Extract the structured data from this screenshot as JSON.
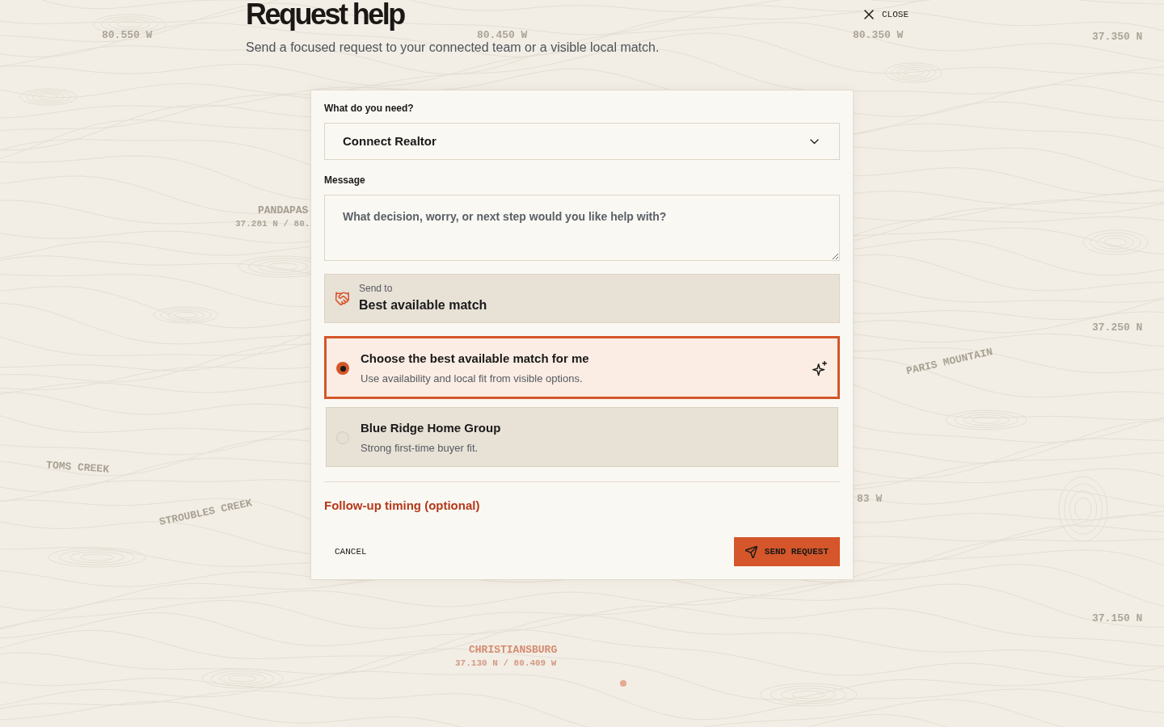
{
  "header": {
    "title": "Request help",
    "subtitle": "Send a focused request to your connected team or a visible local match.",
    "close_button": "CLOSE"
  },
  "form": {
    "need": {
      "label": "What do you need?",
      "value": "Connect Realtor"
    },
    "message": {
      "label": "Message",
      "placeholder": "What decision, worry, or next step would you like help with?"
    },
    "send_to": {
      "label": "Send to",
      "value": "Best available match"
    },
    "options": [
      {
        "kind": "auto",
        "title": "Choose the best available match for me",
        "description": "Use availability and local fit from visible options.",
        "selected": true
      },
      {
        "kind": "agent",
        "title": "Blue Ridge Home Group",
        "description": "Strong first-time buyer fit.",
        "selected": false
      }
    ],
    "follow_up_link": "Follow-up timing (optional)",
    "cancel_button": "CANCEL",
    "submit_button": "SEND REQUEST"
  },
  "map": {
    "grid_labels": [
      "80.550 W",
      "80.450 W",
      "80.350 W",
      "37.350 N",
      "37.250 N",
      "83 W",
      "37.150 N"
    ],
    "feature_labels": [
      "PARIS MOUNTAIN",
      "TOMS CREEK",
      "STROUBLES CREEK"
    ],
    "places": [
      {
        "name": "PANDAPAS",
        "coordinates": "37.281 N / 80.",
        "highlighted": false
      },
      {
        "name": "CHRISTIANSBURG",
        "coordinates": "37.130 N / 80.409 W",
        "highlighted": true
      }
    ]
  }
}
